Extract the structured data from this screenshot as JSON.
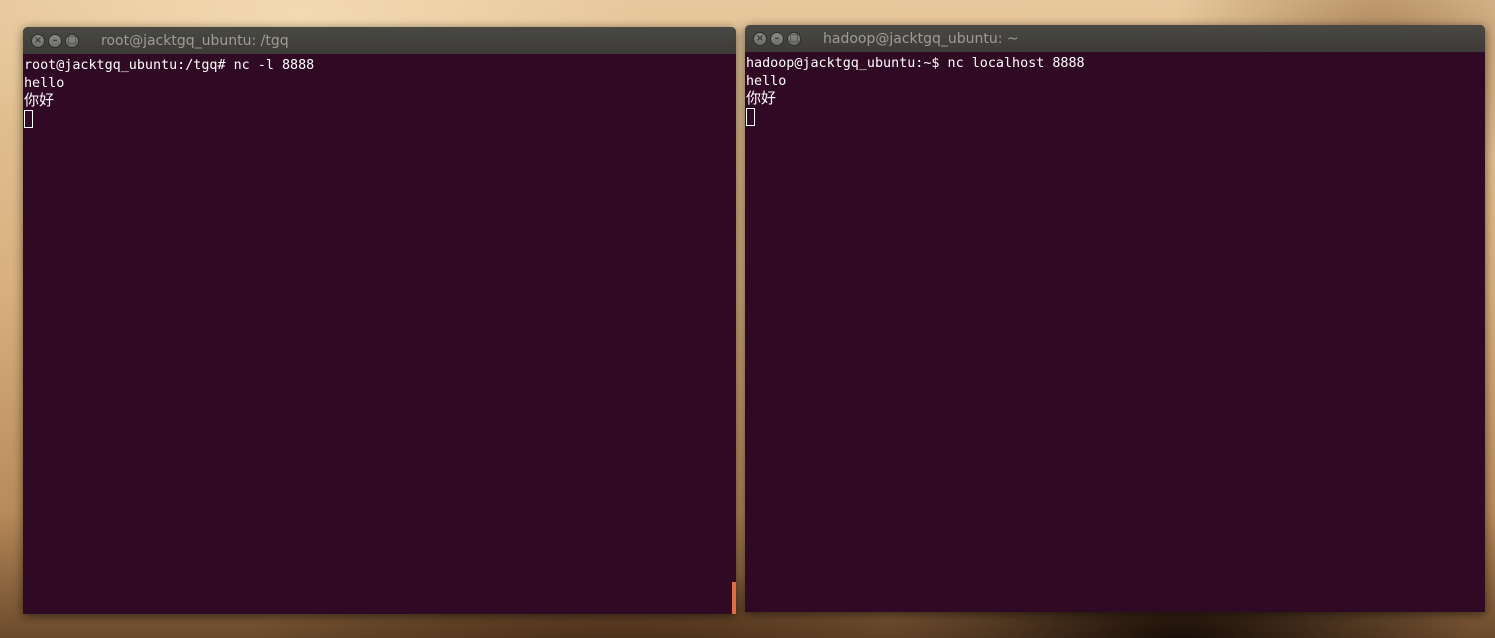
{
  "windows": [
    {
      "title": "root@jacktgq_ubuntu: /tgq",
      "lines": [
        "root@jacktgq_ubuntu:/tgq# nc -l 8888",
        "hello",
        "你好"
      ]
    },
    {
      "title": "hadoop@jacktgq_ubuntu: ~",
      "lines": [
        "hadoop@jacktgq_ubuntu:~$ nc localhost 8888",
        "hello",
        "你好"
      ]
    }
  ],
  "icons": {
    "close": "close-icon",
    "minimize": "minimize-icon",
    "maximize": "maximize-icon"
  },
  "colors": {
    "terminal_bg": "#300a24",
    "terminal_fg": "#ffffff",
    "titlebar": "#3c3b37",
    "scroll_accent": "#e06e45"
  }
}
